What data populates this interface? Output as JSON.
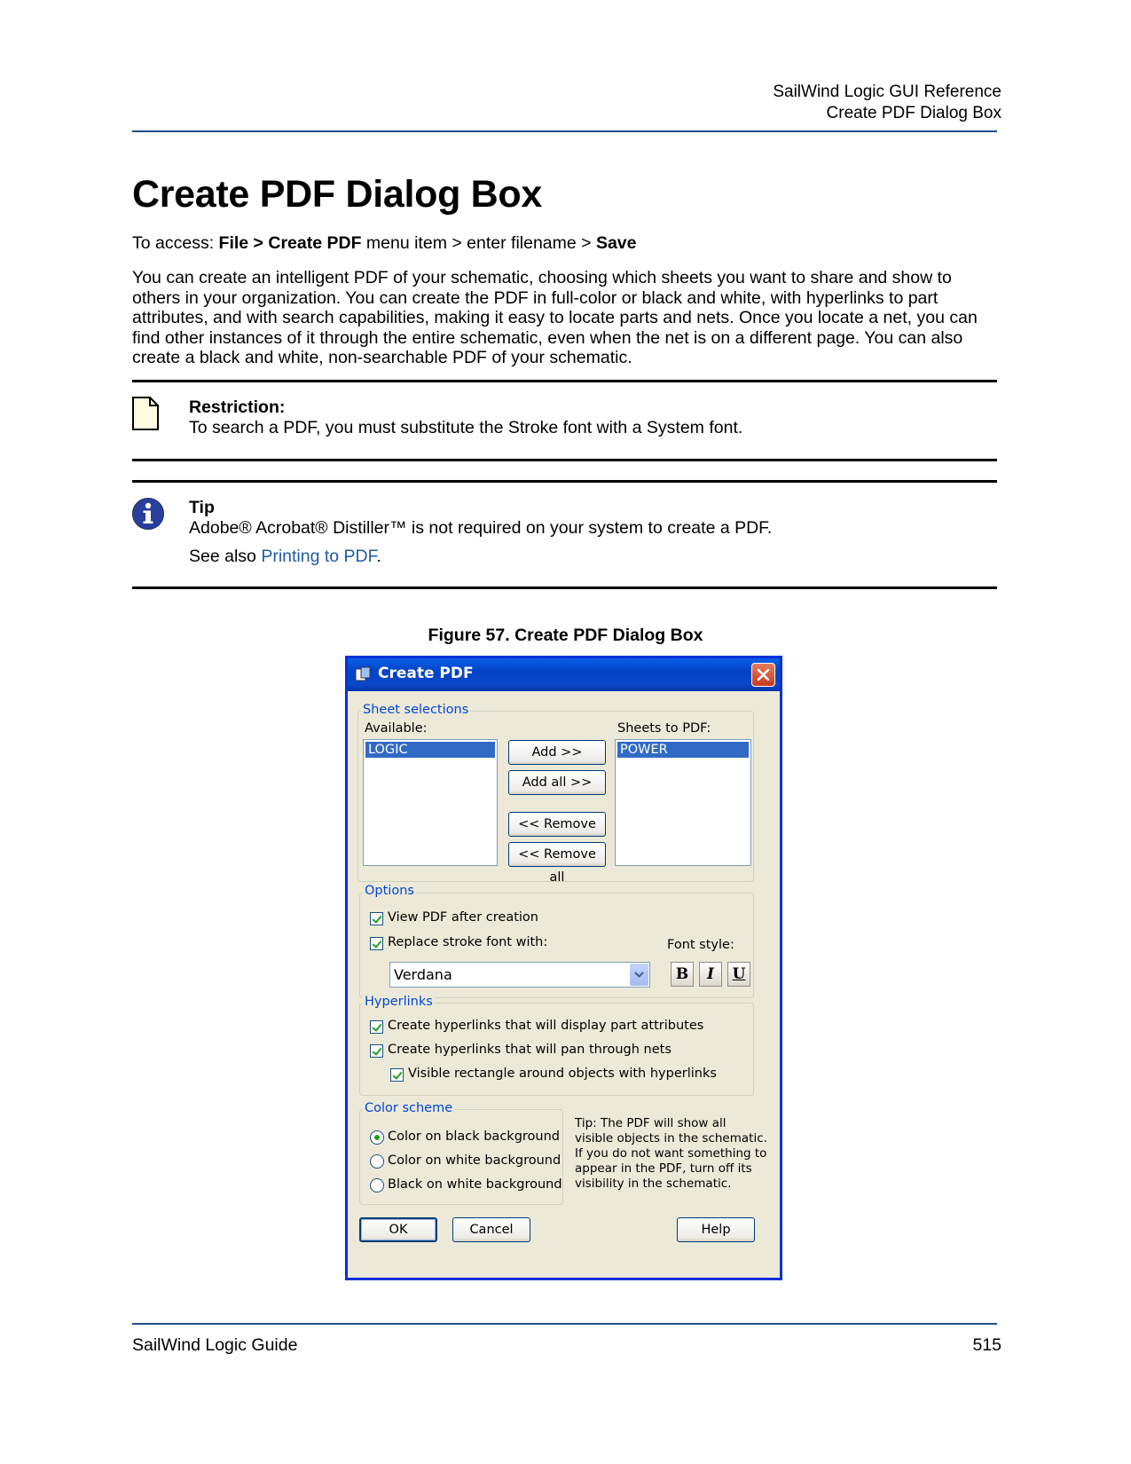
{
  "header": {
    "line1": "SailWind Logic GUI Reference",
    "line2": "Create PDF Dialog Box"
  },
  "title": "Create PDF Dialog Box",
  "access": {
    "prefix": "To access: ",
    "file": "File > Create PDF",
    "mid": " menu item > enter filename > ",
    "save": "Save"
  },
  "intro": "You can create an intelligent PDF of your schematic, choosing which sheets you want to share and show to others in your organization. You can create the PDF in full-color or black and white, with hyperlinks to part attributes, and with search capabilities, making it easy to locate parts and nets. Once you locate a net, you can find other instances of it through the entire schematic, even when the net is on a different page. You can also create a black and white, non-searchable PDF of your schematic.",
  "restriction": {
    "heading": "Restriction:",
    "body": "To search a PDF, you must substitute the Stroke font with a System font."
  },
  "tip": {
    "heading": "Tip",
    "body": "Adobe® Acrobat® Distiller™ is not required on your system to create a PDF.",
    "see_prefix": "See also ",
    "see_link": "Printing to PDF",
    "see_suffix": "."
  },
  "figure_caption": "Figure 57. Create PDF Dialog Box",
  "dialog": {
    "title": "Create PDF",
    "sheet_group": "Sheet selections",
    "available_label": "Available:",
    "available_items": [
      "LOGIC"
    ],
    "sheets_label": "Sheets to PDF:",
    "sheets_items": [
      "POWER"
    ],
    "add": "Add >>",
    "add_all": "Add all >>",
    "remove": "<< Remove",
    "remove_all": "<< Remove all",
    "options_group": "Options",
    "view_pdf": "View PDF after creation",
    "replace_font": "Replace stroke font with:",
    "font_style": "Font style:",
    "font_value": "Verdana",
    "bold": "B",
    "italic": "I",
    "underline": "U",
    "hyperlinks_group": "Hyperlinks",
    "hl_attributes": "Create hyperlinks that will display part attributes",
    "hl_nets": "Create hyperlinks that will pan through nets",
    "hl_rect": "Visible rectangle around objects with hyperlinks",
    "color_group": "Color scheme",
    "color_black": "Color on black background",
    "color_white": "Color on white background",
    "bw": "Black on white background",
    "tip_line1": "Tip: The PDF will show all",
    "tip_line2": "visible objects in the schematic.",
    "tip_line3": "If you do not want something to",
    "tip_line4": "appear in the PDF, turn off its",
    "tip_line5": "visibility in the schematic.",
    "ok": "OK",
    "cancel": "Cancel",
    "help": "Help"
  },
  "footer": {
    "left": "SailWind Logic Guide",
    "page": "515"
  }
}
